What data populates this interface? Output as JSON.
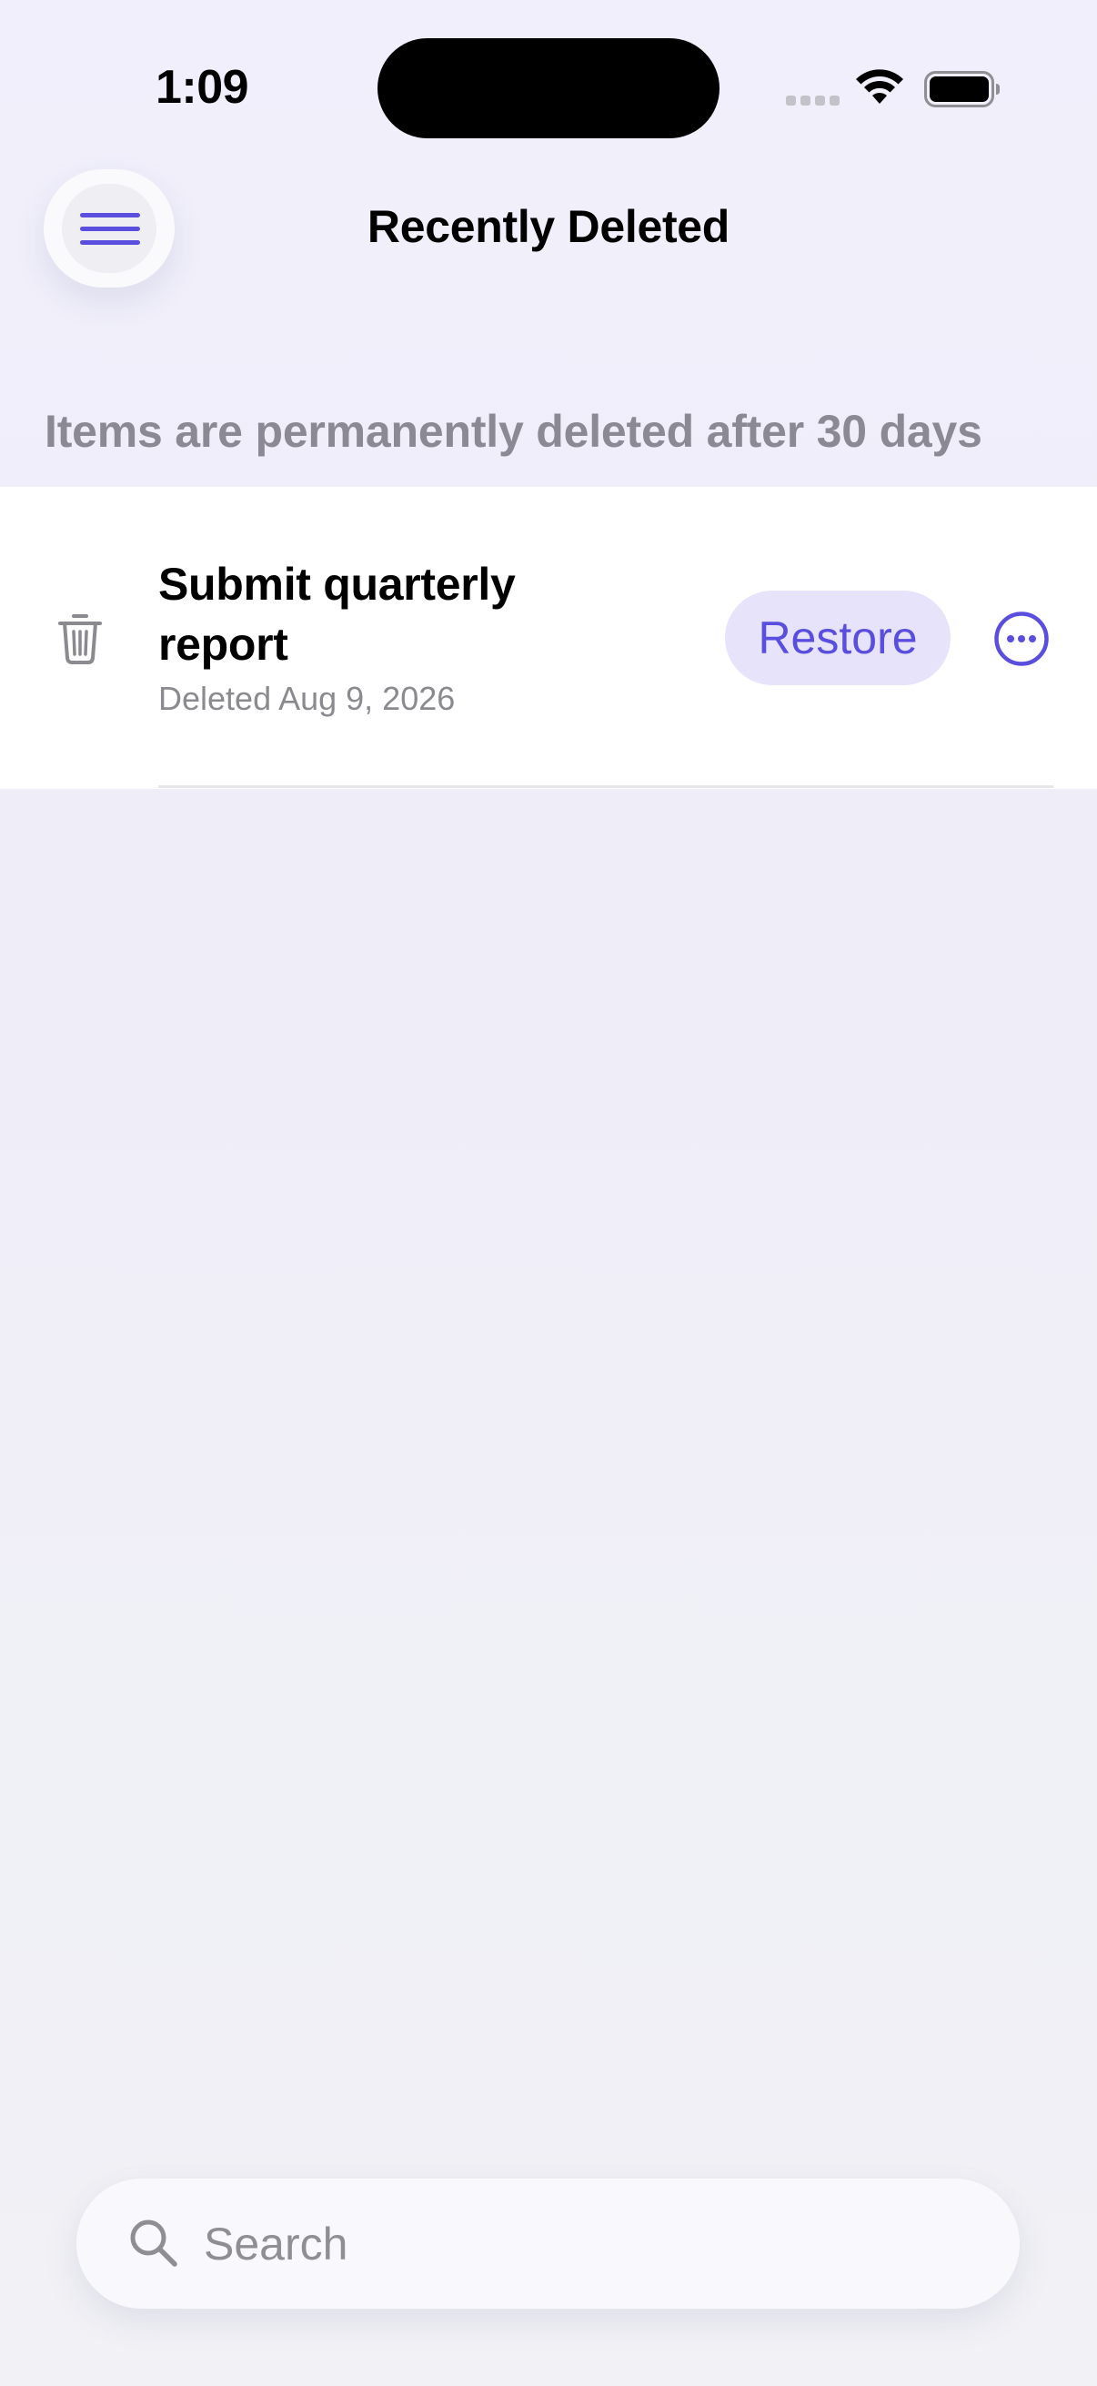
{
  "status_bar": {
    "time": "1:09"
  },
  "nav": {
    "title": "Recently Deleted",
    "menu_icon": "hamburger-icon"
  },
  "notice": "Items are permanently deleted after 30 days",
  "items": [
    {
      "icon": "trash-icon",
      "title": "Submit quarterly report",
      "deleted_date": "Deleted Aug 9, 2026",
      "restore_label": "Restore",
      "more_icon": "ellipsis-circle-icon"
    }
  ],
  "search": {
    "placeholder": "Search",
    "value": ""
  },
  "colors": {
    "accent": "#5a4ede",
    "accent_soft": "#e6e3fb",
    "secondary_text": "#8b8a94",
    "background": "#efeef8"
  }
}
